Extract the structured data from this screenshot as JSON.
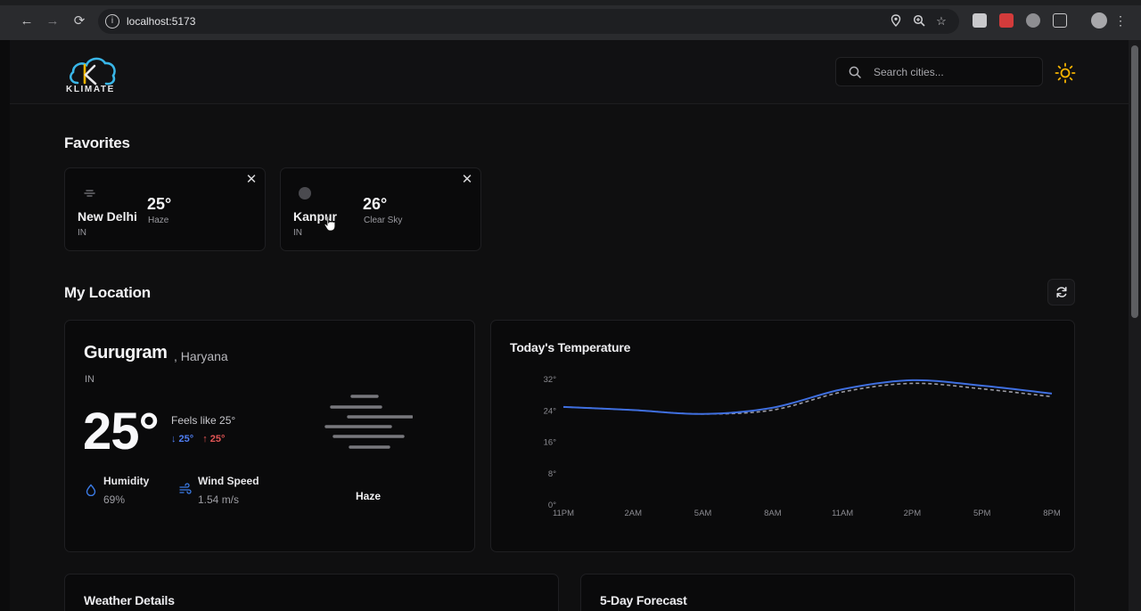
{
  "browser": {
    "url": "localhost:5173",
    "back_icon": "arrow-left-icon",
    "forward_icon": "arrow-right-icon",
    "reload_icon": "reload-icon"
  },
  "app": {
    "logo_text": "KLIMATE",
    "search_placeholder": "Search cities...",
    "accent": "#f5b300"
  },
  "favorites": {
    "title": "Favorites",
    "items": [
      {
        "city": "New Delhi",
        "country": "IN",
        "temp": "25°",
        "condition": "Haze",
        "icon": "haze-icon"
      },
      {
        "city": "Kanpur",
        "country": "IN",
        "temp": "26°",
        "condition": "Clear Sky",
        "icon": "clear-sky-icon"
      }
    ]
  },
  "my_location": {
    "title": "My Location",
    "city": "Gurugram",
    "state": ", Haryana",
    "country": "IN",
    "temp": "25°",
    "feels_like": "Feels like 25°",
    "min": "↓ 25°",
    "max": "↑ 25°",
    "humidity_label": "Humidity",
    "humidity_value": "69%",
    "wind_label": "Wind Speed",
    "wind_value": "1.54 m/s",
    "condition": "Haze"
  },
  "chart_data": {
    "type": "line",
    "title": "Today's Temperature",
    "categories": [
      "11PM",
      "2AM",
      "5AM",
      "8AM",
      "11AM",
      "2PM",
      "5PM",
      "8PM"
    ],
    "yticks": [
      "0°",
      "8°",
      "16°",
      "24°",
      "32°"
    ],
    "ylim": [
      0,
      32
    ],
    "series": [
      {
        "values": [
          25,
          24.2,
          23.2,
          24.8,
          29.5,
          31.8,
          30.4,
          28.4
        ],
        "color": "#3f6fe0",
        "dashed": false
      },
      {
        "values": [
          25,
          24.2,
          23.2,
          24.2,
          28.8,
          31.0,
          29.6,
          27.6
        ],
        "color": "#9a9aa3",
        "dashed": true
      }
    ],
    "grid": false,
    "legend": "none"
  },
  "details": {
    "weather_details_title": "Weather Details",
    "forecast_title": "5-Day Forecast"
  }
}
